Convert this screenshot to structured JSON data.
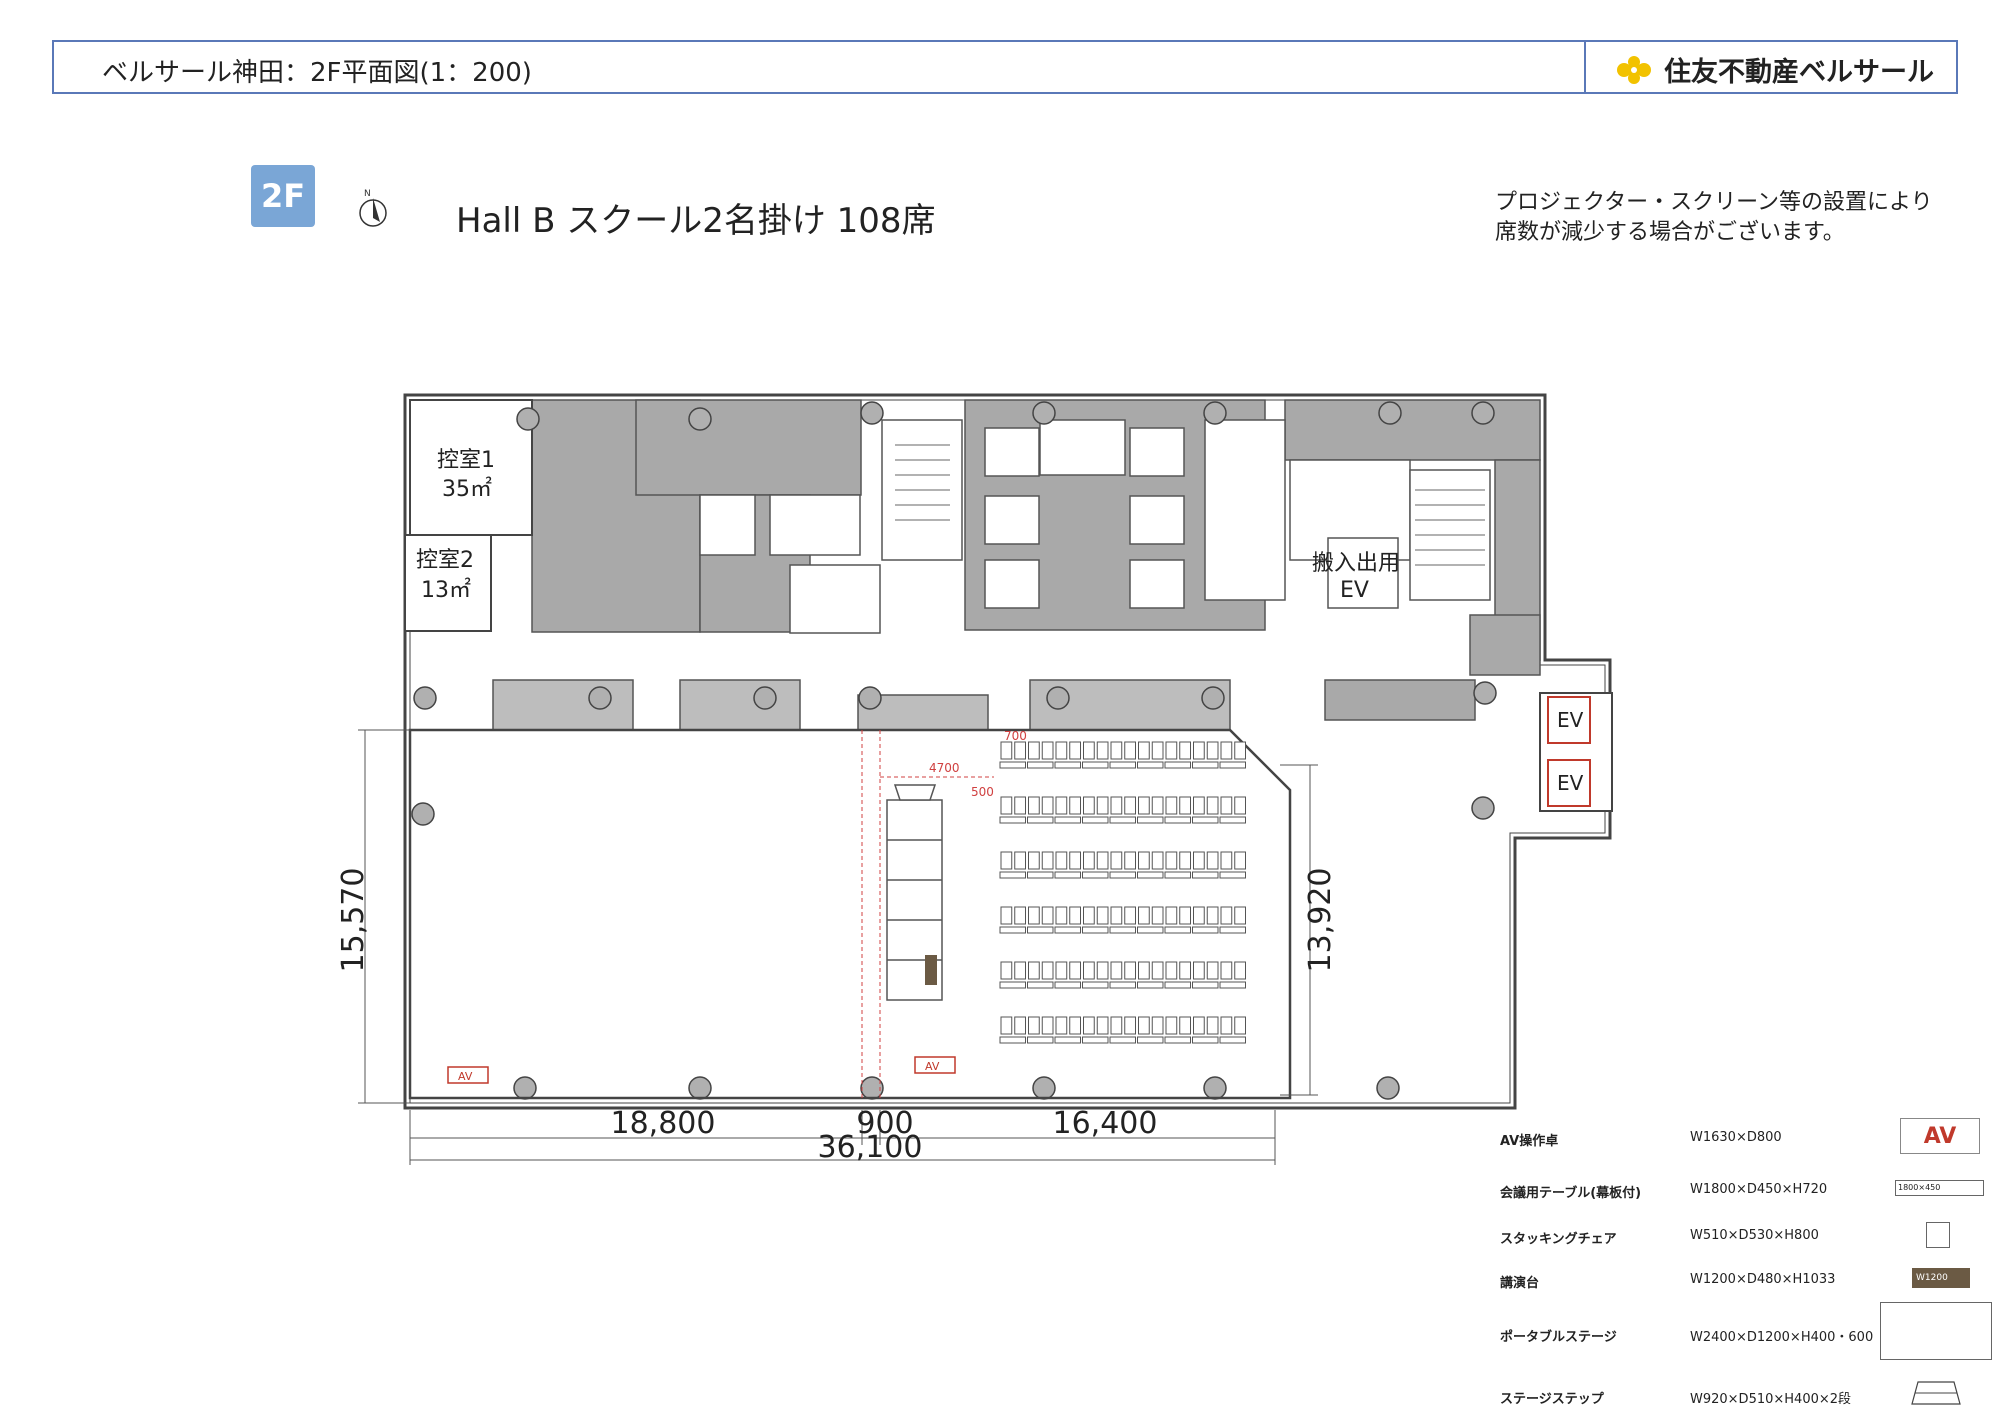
{
  "header": {
    "title": "ベルサール神田：2F平面図(1：200)",
    "brand": "住友不動産ベルサール",
    "brand_color": "#f2c200",
    "border_color": "#5a78b8"
  },
  "floor_badge": "2F",
  "subtitle": "Hall B スクール2名掛け 108席",
  "note": {
    "line1": "プロジェクター・スクリーン等の設置により",
    "line2": "席数が減少する場合がございます。"
  },
  "compass_label": "N",
  "rooms": {
    "hikae1_name": "控室1",
    "hikae1_area": "35㎡",
    "hikae2_name": "控室2",
    "hikae2_area": "13㎡",
    "cargo_ev_line1": "搬入出用",
    "cargo_ev_line2": "EV",
    "ev1": "EV",
    "ev2": "EV",
    "av1": "AV",
    "av2": "AV"
  },
  "dimensions": {
    "left_height": "15,570",
    "right_height": "13,920",
    "bottom_left": "18,800",
    "bottom_mid": "900",
    "bottom_right": "16,400",
    "bottom_total": "36,100",
    "red_700": "700",
    "red_4700": "4700",
    "red_500": "500"
  },
  "seating": {
    "rows": 6,
    "desks_per_row": 9,
    "seats_per_desk": 2,
    "total": 108
  },
  "legend": [
    {
      "name": "AV操作卓",
      "spec": "W1630×D800",
      "symbol": "AV"
    },
    {
      "name": "会議用テーブル(幕板付)",
      "spec": "W1800×D450×H720",
      "symbol": "1800×450"
    },
    {
      "name": "スタッキングチェア",
      "spec": "W510×D530×H800",
      "symbol": ""
    },
    {
      "name": "講演台",
      "spec": "W1200×D480×H1033",
      "symbol": "W1200"
    },
    {
      "name": "ポータブルステージ",
      "spec": "W2400×D1200×H400・600",
      "symbol": ""
    },
    {
      "name": "ステージステップ",
      "spec": "W920×D510×H400×2段",
      "symbol": ""
    }
  ],
  "colors": {
    "service_fill": "#a9a9a9",
    "wall": "#444444",
    "dimension_red": "#d04040",
    "av_red": "#c0392b"
  }
}
